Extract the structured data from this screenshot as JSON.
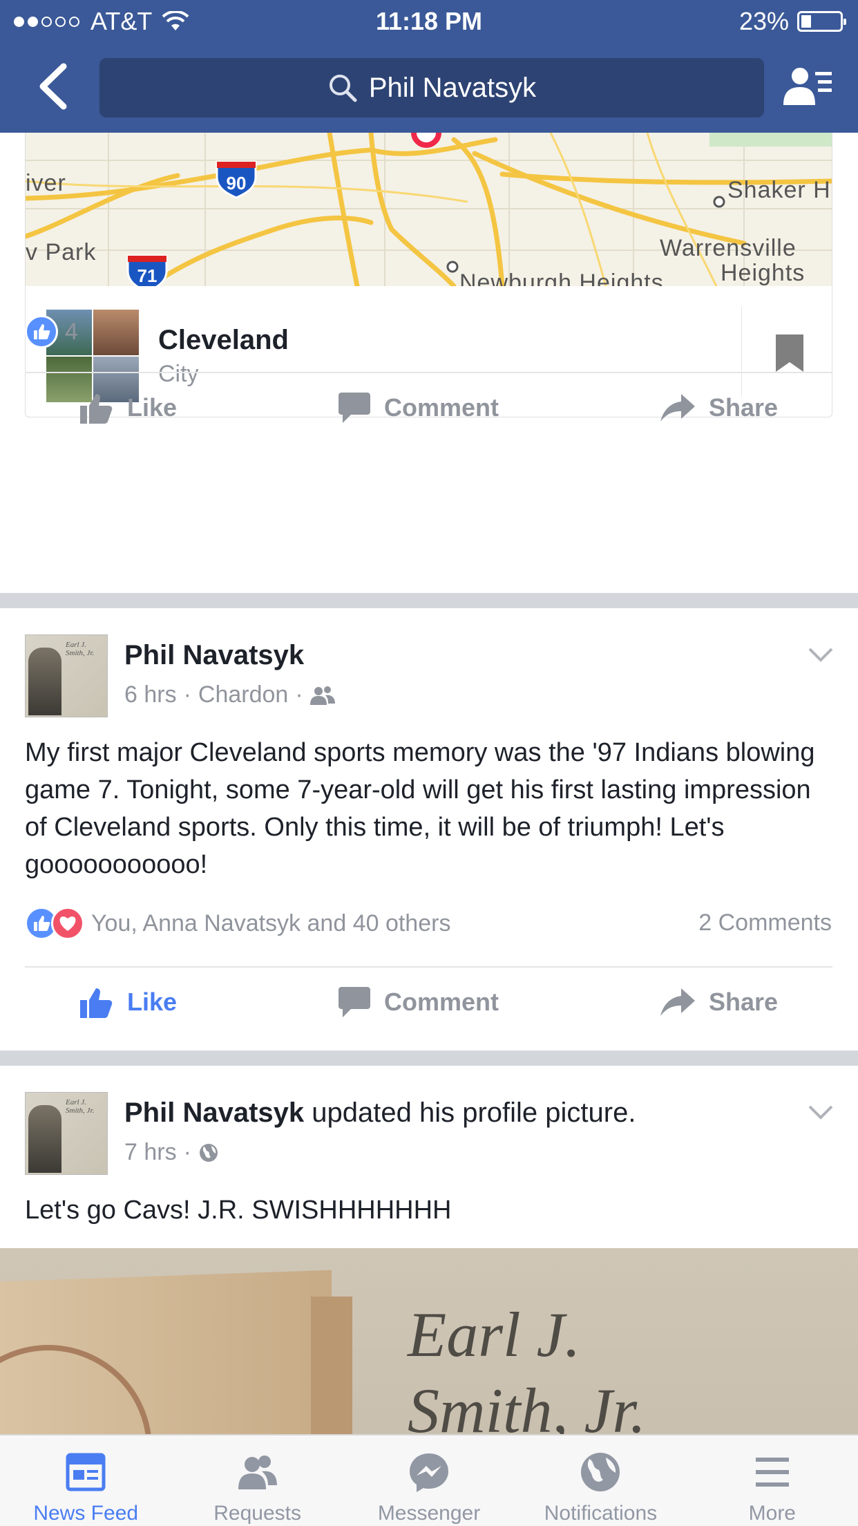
{
  "status_bar": {
    "carrier": "AT&T",
    "time": "11:18 PM",
    "battery": "23%",
    "signal_bars_filled": 2,
    "signal_bars_total": 5
  },
  "nav": {
    "search_text": "Phil Navatsyk",
    "icons": [
      "back-chevron-icon",
      "search-icon",
      "friends-list-icon"
    ]
  },
  "map": {
    "labels": {
      "river": "iver",
      "park": "v Park",
      "i90": "90",
      "i71": "71",
      "shaker": "Shaker H",
      "warrensville_line1": "Warrensville",
      "warrensville_line2": "Heights",
      "newburgh": "Newburgh Heights"
    }
  },
  "place_card": {
    "name": "Cleveland",
    "type": "City"
  },
  "post1": {
    "like_count": "4"
  },
  "actions": {
    "like": "Like",
    "comment": "Comment",
    "share": "Share"
  },
  "post2": {
    "author": "Phil Navatsyk",
    "time": "6 hrs",
    "location": "Chardon",
    "privacy_icon": "friends-icon",
    "text": "My first major Cleveland sports memory was the '97 Indians blowing game 7. Tonight, some 7-year-old will get his first lasting impression of Cleveland sports. Only this time, it will be of triumph! Let's gooooooooooo!",
    "reactions": "You, Anna Navatsyk and 40 others",
    "comments": "2 Comments",
    "liked": true
  },
  "post3": {
    "author": "Phil Navatsyk",
    "action": "updated his profile picture.",
    "time": "7 hrs",
    "privacy_icon": "globe-icon",
    "text": "Let's go Cavs! J.R. SWISHHHHHHH",
    "photo_caption_line1": "Earl J.",
    "photo_caption_line2": "Smith, Jr."
  },
  "avatar_caption": {
    "line1": "Earl J.",
    "line2": "Smith, Jr."
  },
  "tabbar": {
    "tabs": [
      {
        "label": "News Feed",
        "icon": "news-feed-icon",
        "active": true
      },
      {
        "label": "Requests",
        "icon": "requests-icon",
        "active": false
      },
      {
        "label": "Messenger",
        "icon": "messenger-icon",
        "active": false
      },
      {
        "label": "Notifications",
        "icon": "globe-icon",
        "active": false
      },
      {
        "label": "More",
        "icon": "menu-icon",
        "active": false
      }
    ]
  },
  "colors": {
    "brand": "#3b5998",
    "active_blue": "#4a7df2",
    "muted": "#90949c",
    "love": "#f25268"
  }
}
